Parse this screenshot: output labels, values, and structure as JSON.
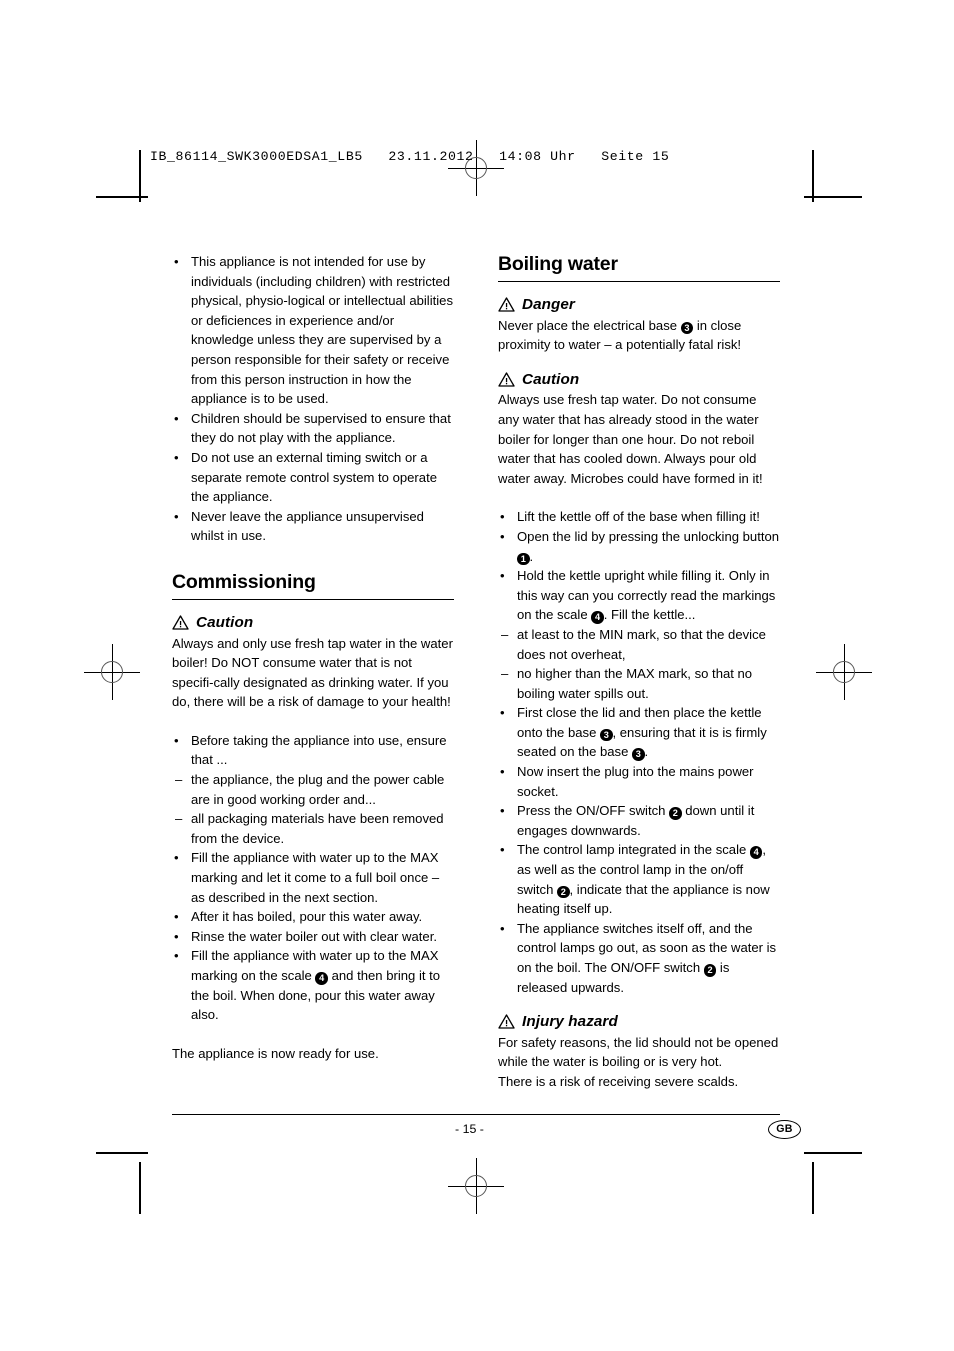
{
  "print_header": "IB_86114_SWK3000EDSA1_LB5   23.11.2012   14:08 Uhr   Seite 15",
  "footer": {
    "page_number": "- 15 -",
    "language_badge": "GB"
  },
  "left_column": {
    "top_bullets": [
      {
        "marker": "•",
        "text": "This appliance is not intended for use by individuals (including children) with restricted physical, physio-logical or intellectual abilities or deficiences in experience and/or knowledge unless they are supervised by a person responsible for their safety or receive from this person instruction in how the appliance is to be used."
      },
      {
        "marker": "•",
        "text": "Children should be supervised to ensure that they do not play with the appliance."
      },
      {
        "marker": "•",
        "text": "Do not use an external timing switch or a separate remote control system to operate the appliance."
      },
      {
        "marker": "•",
        "text": "Never leave the appliance unsupervised whilst in use."
      }
    ],
    "heading": "Commissioning",
    "caution": {
      "label": "Caution",
      "icon": "warning-triangle-icon",
      "text": "Always and only use fresh tap water in the water boiler! Do NOT consume water that is not specifi-cally designated as drinking water. If you do, there will be a risk of damage to your health!"
    },
    "bullets": [
      {
        "marker": "•",
        "text": "Before taking the appliance into use, ensure that ..."
      },
      {
        "marker": "–",
        "text": "the appliance, the plug and the power cable are in good working order and..."
      },
      {
        "marker": "–",
        "text": "all packaging materials have been removed from the device."
      },
      {
        "marker": "•",
        "text": "Fill the appliance with water up to the MAX marking and let it come to a full boil once – as described in the next section."
      },
      {
        "marker": "•",
        "text": "After it has boiled, pour this water away."
      },
      {
        "marker": "•",
        "text": "Rinse the water boiler out with clear water."
      },
      {
        "marker": "•",
        "text_before": "Fill the appliance with water up to the MAX marking on the scale ",
        "ref": "4",
        "text_after": " and then bring it to the boil. When done, pour this water away also."
      }
    ],
    "closing": "The appliance is now ready for use."
  },
  "right_column": {
    "heading": "Boiling water",
    "danger": {
      "label": "Danger",
      "icon": "warning-triangle-icon",
      "text_before": "Never place the electrical base ",
      "ref": "3",
      "text_after": " in close proximity to water – a potentially fatal risk!"
    },
    "caution": {
      "label": "Caution",
      "icon": "warning-triangle-icon",
      "text": "Always use fresh tap water. Do not consume any water that has already stood in the water boiler for longer than one hour. Do not reboil water that has cooled down. Always pour old water away. Microbes could have formed in it!"
    },
    "bullets": [
      {
        "marker": "•",
        "text": "Lift the kettle off of the base when filling it!"
      },
      {
        "marker": "•",
        "text_before": "Open the lid by pressing the unlocking button ",
        "ref": "1",
        "text_after": "."
      },
      {
        "marker": "•",
        "text_before": "Hold the kettle upright while filling it. Only in this way can you correctly read the markings on the scale ",
        "ref": "4",
        "text_after": ". Fill the kettle..."
      },
      {
        "marker": "–",
        "text": "at least to the MIN mark, so that the device does not overheat,"
      },
      {
        "marker": "–",
        "text": "no higher than the MAX mark, so that no boiling water spills out."
      },
      {
        "marker": "•",
        "text_before": "First close the lid and then place the kettle onto the base ",
        "ref": "3",
        "text_mid": ", ensuring that it is is firmly seated on the base ",
        "ref2": "3",
        "text_after": "."
      },
      {
        "marker": "•",
        "text": "Now insert the plug into the mains power socket."
      },
      {
        "marker": "•",
        "text_before": "Press the ON/OFF switch ",
        "ref": "2",
        "text_after": " down until it engages downwards."
      },
      {
        "marker": "•",
        "text_before": "The control lamp integrated in the scale ",
        "ref": "4",
        "text_mid": ", as well as the control lamp in the on/off switch ",
        "ref2": "2",
        "text_after": ", indicate that the appliance is now heating itself up."
      },
      {
        "marker": "•",
        "text_before": "The appliance switches itself off, and the control lamps go out, as soon as the water is on the boil. The ON/OFF switch ",
        "ref": "2",
        "text_after": " is released upwards."
      }
    ],
    "injury": {
      "label": "Injury hazard",
      "icon": "warning-triangle-icon",
      "line1": "For safety reasons, the lid should not be opened while the water is boiling or is very hot.",
      "line2": "There is a risk of receiving severe scalds."
    }
  }
}
